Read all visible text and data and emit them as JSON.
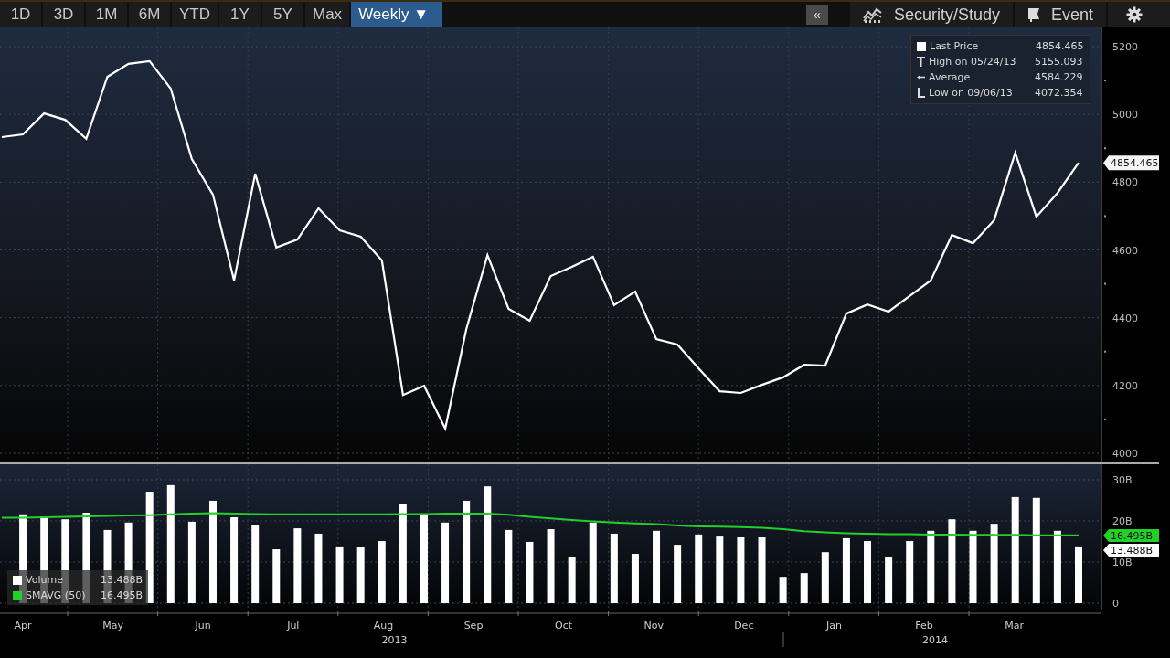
{
  "toolbar": {
    "ranges": [
      {
        "label": "1D",
        "selected": false
      },
      {
        "label": "3D",
        "selected": false
      },
      {
        "label": "1M",
        "selected": false
      },
      {
        "label": "6M",
        "selected": false
      },
      {
        "label": "YTD",
        "selected": false
      },
      {
        "label": "1Y",
        "selected": false
      },
      {
        "label": "5Y",
        "selected": false
      },
      {
        "label": "Max",
        "selected": false
      },
      {
        "label": "Weekly ▼",
        "selected": true
      }
    ],
    "collapse": "«",
    "tools": [
      {
        "label": "Security/Study",
        "kind": "study"
      },
      {
        "label": "Event",
        "kind": "event"
      }
    ]
  },
  "price_chart": {
    "legend": [
      {
        "kind": "last",
        "value": "4854.465"
      },
      {
        "kind": "high",
        "label": "High on  05/24/13",
        "value": "5155.093"
      },
      {
        "kind": "average",
        "label": "Average",
        "value": "4584.229"
      },
      {
        "kind": "low",
        "label": "Low on 09/06/13",
        "value": "4072.354"
      }
    ],
    "last_price_tag": "4854.465",
    "chart_data": {
      "type": "line",
      "grid": true,
      "ylim": [
        4000,
        5200
      ],
      "yticks": [
        4000,
        4200,
        4400,
        4600,
        4800,
        5000,
        5200
      ],
      "series": [
        {
          "name": "Last Price",
          "color": "#ffffff",
          "values": [
            4933,
            4941,
            5003,
            4984,
            4928,
            5111,
            5149,
            5157,
            5076,
            4868,
            4763,
            4510,
            4825,
            4607,
            4631,
            4723,
            4658,
            4639,
            4569,
            4172,
            4199,
            4073,
            4367,
            4585,
            4426,
            4391,
            4523,
            4550,
            4580,
            4437,
            4477,
            4337,
            4321,
            4251,
            4183,
            4178,
            4202,
            4224,
            4261,
            4259,
            4412,
            4439,
            4418,
            4464,
            4510,
            4644,
            4620,
            4688,
            4887,
            4698,
            4768,
            4857
          ]
        }
      ]
    }
  },
  "volume_chart": {
    "legend": [
      {
        "value": "13.488B"
      },
      {
        "value": "16.495B"
      }
    ],
    "tags": [
      {
        "value": "16.495B",
        "color": "#22d02a"
      },
      {
        "value": "13.488B",
        "color": "#ffffff"
      }
    ],
    "chart_data": {
      "type": "bar",
      "grid": true,
      "ylim": [
        0,
        30
      ],
      "yticks": [
        {
          "value": 0,
          "label": "0"
        },
        {
          "value": 10,
          "label": "10B"
        },
        {
          "value": 20,
          "label": "20B"
        },
        {
          "value": 30,
          "label": "30B"
        }
      ],
      "series": [
        {
          "name": "Volume",
          "color": "#ffffff",
          "values": [
            null,
            21.6,
            21.1,
            20.4,
            22.0,
            17.8,
            19.6,
            27.1,
            28.7,
            19.8,
            24.9,
            20.9,
            18.9,
            13.1,
            18.2,
            16.9,
            13.8,
            13.6,
            15.1,
            24.2,
            21.8,
            19.6,
            24.9,
            28.4,
            17.8,
            14.9,
            18.0,
            11.1,
            19.6,
            16.9,
            12.0,
            17.6,
            14.2,
            16.7,
            16.2,
            16.0,
            16.0,
            6.4,
            7.3,
            12.4,
            15.8,
            15.1,
            11.1,
            15.1,
            17.6,
            20.4,
            17.6,
            19.3,
            25.8,
            25.6,
            17.6,
            13.8
          ]
        }
      ]
    },
    "average_line": {
      "chart_data": {
        "type": "line",
        "ylim": [
          0,
          30
        ],
        "series": [
          {
            "name": "SMAVG (50)",
            "color": "#22d02a",
            "values": [
              20.8,
              20.8,
              20.9,
              21.0,
              21.1,
              21.2,
              21.3,
              21.4,
              21.6,
              21.8,
              21.9,
              21.8,
              21.7,
              21.6,
              21.6,
              21.6,
              21.6,
              21.6,
              21.6,
              21.7,
              21.7,
              21.8,
              21.8,
              21.8,
              21.5,
              21.0,
              20.6,
              20.2,
              19.9,
              19.6,
              19.4,
              19.2,
              18.9,
              18.7,
              18.6,
              18.5,
              18.3,
              18.0,
              17.5,
              17.2,
              17.0,
              16.9,
              16.8,
              16.8,
              16.7,
              16.7,
              16.6,
              16.6,
              16.6,
              16.5,
              16.5,
              16.5
            ]
          }
        ]
      }
    }
  },
  "time_axis": {
    "months": [
      {
        "label": "Apr"
      },
      {
        "label": "May"
      },
      {
        "label": "Jun"
      },
      {
        "label": "Jul"
      },
      {
        "label": "Aug",
        "year": "2013"
      },
      {
        "label": "Sep"
      },
      {
        "label": "Oct"
      },
      {
        "label": "Nov"
      },
      {
        "label": "Dec"
      },
      {
        "label": "Jan"
      },
      {
        "label": "Feb",
        "year": "2014"
      },
      {
        "label": "Mar"
      }
    ]
  }
}
